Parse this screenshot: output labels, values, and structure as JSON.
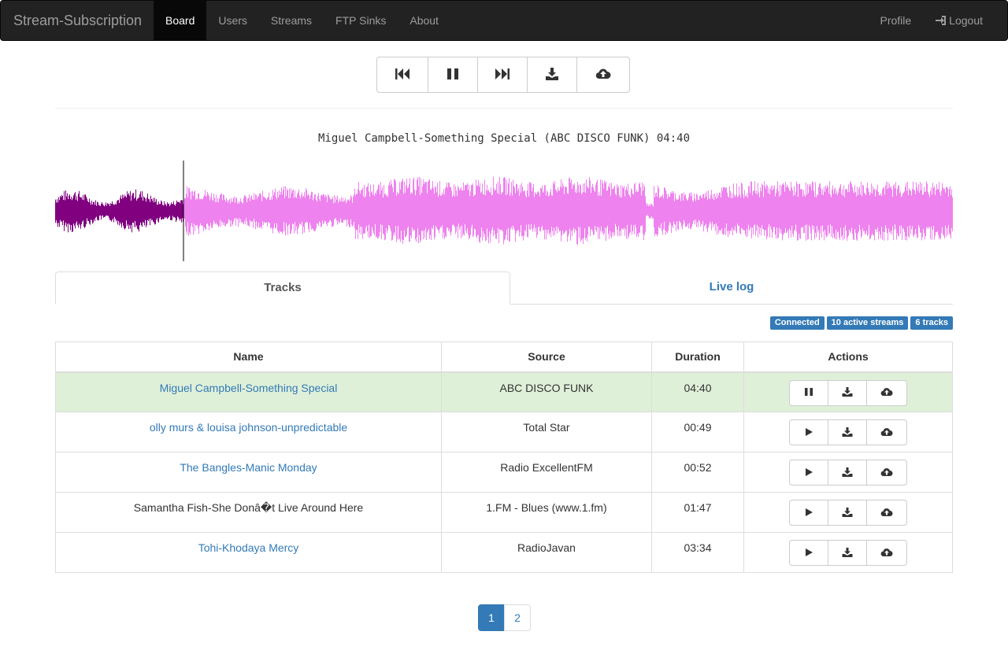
{
  "app": {
    "brand": "Stream-Subscription"
  },
  "nav": {
    "items": [
      {
        "label": "Board"
      },
      {
        "label": "Users"
      },
      {
        "label": "Streams"
      },
      {
        "label": "FTP Sinks"
      },
      {
        "label": "About"
      }
    ],
    "active": "Board",
    "profile": "Profile",
    "logout": "Logout"
  },
  "player": {
    "buttons": [
      "skip-back-icon",
      "pause-icon",
      "skip-forward-icon",
      "download-icon",
      "cloud-upload-icon"
    ],
    "now_playing": "Miguel Campbell-Something Special (ABC DISCO FUNK) 04:40",
    "progress": 0.143,
    "colors": {
      "played": "#800080",
      "remaining": "#ee82ee",
      "cursor": "#000000"
    }
  },
  "tabs": [
    {
      "label": "Tracks",
      "active": true
    },
    {
      "label": "Live log",
      "active": false
    }
  ],
  "badges": [
    "Connected",
    "10 active streams",
    "6 tracks"
  ],
  "table": {
    "headers": [
      "Name",
      "Source",
      "Duration",
      "Actions"
    ],
    "rows": [
      {
        "name": "Miguel Campbell-Something Special",
        "source": "ABC DISCO FUNK",
        "duration": "04:40",
        "playing": true,
        "linked": true
      },
      {
        "name": "olly murs & louisa johnson-unpredictable",
        "source": "Total Star",
        "duration": "00:49",
        "playing": false,
        "linked": true
      },
      {
        "name": "The Bangles-Manic Monday",
        "source": "Radio ExcellentFM",
        "duration": "00:52",
        "playing": false,
        "linked": true
      },
      {
        "name": "Samantha Fish-She Donâ�t Live Around Here",
        "source": "1.FM - Blues (www.1.fm)",
        "duration": "01:47",
        "playing": false,
        "linked": false
      },
      {
        "name": "Tohi-Khodaya Mercy",
        "source": "RadioJavan",
        "duration": "03:34",
        "playing": false,
        "linked": true
      }
    ]
  },
  "pagination": {
    "pages": [
      "1",
      "2"
    ],
    "current": "1"
  },
  "colors": {
    "link": "#337ab7",
    "row_active": "#dff0d8",
    "navbar": "#222222"
  }
}
